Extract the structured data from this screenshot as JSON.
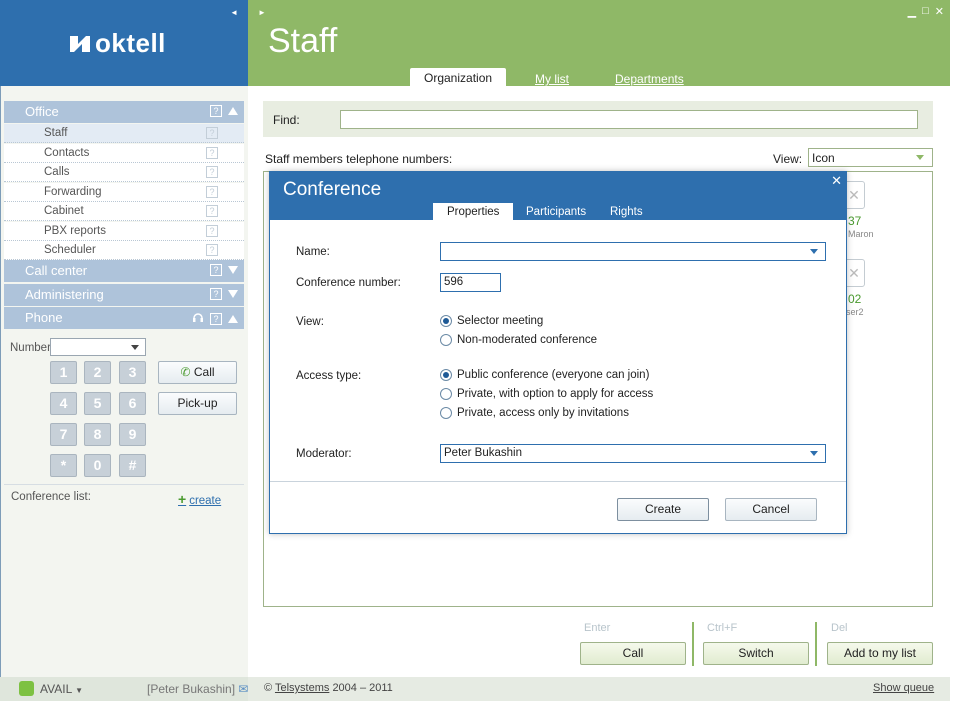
{
  "app": {
    "logo_text": "oktell"
  },
  "left": {
    "sections": {
      "office": "Office",
      "call_center": "Call center",
      "administering": "Administering",
      "phone": "Phone"
    },
    "office_items": [
      "Staff",
      "Contacts",
      "Calls",
      "Forwarding",
      "Cabinet",
      "PBX reports",
      "Scheduler"
    ],
    "help_glyph": "?",
    "number_label": "Number:",
    "number_value": "",
    "keypad": [
      "1",
      "2",
      "3",
      "4",
      "5",
      "6",
      "7",
      "8",
      "9",
      "*",
      "0",
      "#"
    ],
    "call_button": "Call",
    "pickup_button": "Pick-up",
    "conference_list_label": "Conference list:",
    "create_link": "create",
    "status": "AVAIL",
    "status_arrow": "▼",
    "user": "[Peter Bukashin]"
  },
  "main": {
    "title": "Staff",
    "tabs": [
      "Organization",
      "My list",
      "Departments"
    ],
    "find_label": "Find:",
    "find_value": "",
    "staff_label": "Staff members telephone numbers:",
    "view_label": "View:",
    "view_value": "Icon",
    "staff_cards": [
      {
        "number": "37",
        "name": "Maron"
      },
      {
        "number": "02",
        "name": "ser2"
      }
    ],
    "hints": [
      "Enter",
      "Ctrl+F",
      "Del"
    ],
    "actions": [
      "Call",
      "Switch",
      "Add to my list"
    ],
    "footer": {
      "copyright_prefix": "©",
      "company": "Telsystems",
      "years": "2004 – 2011",
      "show_queue": "Show queue"
    }
  },
  "modal": {
    "title": "Conference",
    "tabs": [
      "Properties",
      "Participants",
      "Rights"
    ],
    "fields": {
      "name_label": "Name:",
      "name_value": "",
      "number_label": "Conference number:",
      "number_value": "596",
      "view_label": "View:",
      "view_options": [
        "Selector meeting",
        "Non-moderated conference"
      ],
      "view_selected": 0,
      "access_label": "Access type:",
      "access_options": [
        "Public conference (everyone can join)",
        "Private, with option to apply for access",
        "Private, access only by invitations"
      ],
      "access_selected": 0,
      "moderator_label": "Moderator:",
      "moderator_value": "Peter Bukashin"
    },
    "create_button": "Create",
    "cancel_button": "Cancel"
  },
  "colors": {
    "brand_blue": "#2e6fae",
    "brand_green": "#8fb867",
    "status_green": "#7dc142"
  }
}
